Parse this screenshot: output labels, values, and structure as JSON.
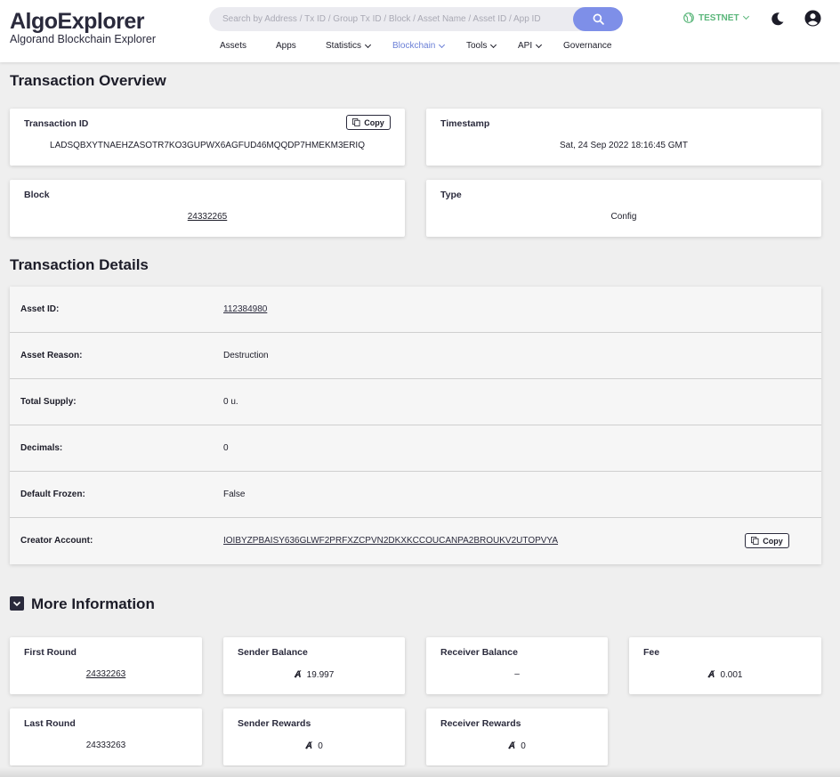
{
  "header": {
    "logo_title": "AlgoExplorer",
    "logo_subtitle": "Algorand Blockchain Explorer",
    "search_placeholder": "Search by Address / Tx ID / Group Tx ID / Block / Asset Name / Asset ID / App ID",
    "network_label": "TESTNET",
    "accent_color": "#7e8fe8",
    "network_color": "#5ab67a",
    "nav": [
      {
        "label": "Assets"
      },
      {
        "label": "Apps"
      },
      {
        "label": "Statistics"
      },
      {
        "label": "Blockchain"
      },
      {
        "label": "Tools"
      },
      {
        "label": "API"
      },
      {
        "label": "Governance"
      }
    ]
  },
  "overview": {
    "title": "Transaction Overview",
    "transaction_id_label": "Transaction ID",
    "transaction_id": "LADSQBXYTNAEHZASOTR7KO3GUPWX6AGFUD46MQQDP7HMEKM3ERIQ",
    "copy_label": "Copy",
    "timestamp_label": "Timestamp",
    "timestamp": "Sat, 24 Sep 2022 18:16:45 GMT",
    "block_label": "Block",
    "block": "24332265",
    "type_label": "Type",
    "type": "Config"
  },
  "details": {
    "title": "Transaction Details",
    "rows": [
      {
        "label": "Asset ID:",
        "value": "112384980"
      },
      {
        "label": "Asset Reason:",
        "value": "Destruction"
      },
      {
        "label": "Total Supply:",
        "value": "0 u."
      },
      {
        "label": "Decimals:",
        "value": "0"
      },
      {
        "label": "Default Frozen:",
        "value": "False"
      },
      {
        "label": "Creator Account:",
        "value": "IOIBYZPBAISY636GLWF2PRFXZCPVN2DKXKCCOUCANPA2BROUKV2UTOPVYA"
      }
    ],
    "copy_label": "Copy"
  },
  "more": {
    "title": "More Information",
    "algo_symbol": "Ⱥ",
    "first_round_label": "First Round",
    "first_round": "24332263",
    "sender_balance_label": "Sender Balance",
    "sender_balance": "19.997",
    "receiver_balance_label": "Receiver Balance",
    "receiver_balance": "–",
    "fee_label": "Fee",
    "fee": "0.001",
    "last_round_label": "Last Round",
    "last_round": "24333263",
    "sender_rewards_label": "Sender Rewards",
    "sender_rewards": "0",
    "receiver_rewards_label": "Receiver Rewards",
    "receiver_rewards": "0"
  }
}
